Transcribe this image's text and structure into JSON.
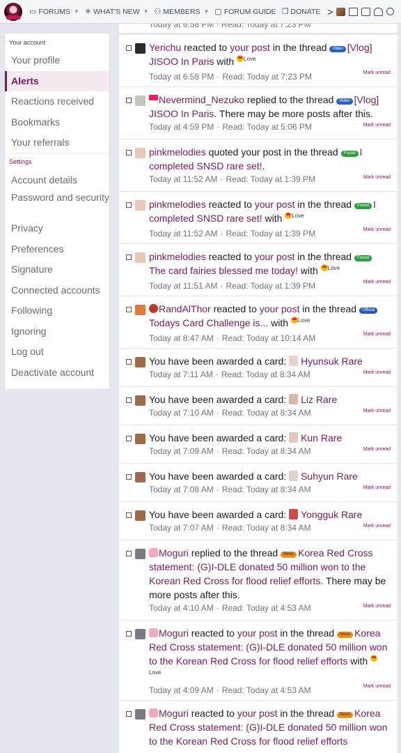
{
  "nav": {
    "items": [
      {
        "label": "FORUMS",
        "icon": "chat-icon",
        "caret": true
      },
      {
        "label": "WHAT'S NEW",
        "icon": "sparkle-icon",
        "caret": true
      },
      {
        "label": "MEMBERS",
        "icon": "members-icon",
        "caret": true
      },
      {
        "label": "FORUM GUIDE",
        "icon": "folder-icon",
        "caret": false
      },
      {
        "label": "DONATE",
        "icon": "gift-icon",
        "caret": false
      }
    ],
    "more_arrow": ">",
    "colors": {
      "bg": "#f5f6f8",
      "text": "#3d4a5f"
    }
  },
  "sidebar": {
    "account_heading": "Your account",
    "account_items": [
      {
        "label": "Your profile",
        "active": false
      },
      {
        "label": "Alerts",
        "active": true
      },
      {
        "label": "Reactions received",
        "active": false
      },
      {
        "label": "Bookmarks",
        "active": false
      },
      {
        "label": "Your referrals",
        "active": false
      }
    ],
    "settings_heading": "Settings",
    "settings_items": [
      {
        "label": "Account details",
        "two": false
      },
      {
        "label": "Password and security",
        "two": true
      },
      {
        "label": "Privacy",
        "two": false
      },
      {
        "label": "Preferences",
        "two": false
      },
      {
        "label": "Signature",
        "two": false
      },
      {
        "label": "Connected accounts",
        "two": false
      },
      {
        "label": "Following",
        "two": false
      },
      {
        "label": "Ignoring",
        "two": false
      },
      {
        "label": "Log out",
        "two": false
      },
      {
        "label": "Deactivate account",
        "two": false
      }
    ],
    "colors": {
      "accent": "#7b1a5a",
      "active_bg": "#f3eaf0"
    }
  },
  "alerts": {
    "mark_unread": "Mark unread",
    "read_label": "Read:",
    "partial_meta": "Today at 6:58 PM · Read: Today at 7:23 PM",
    "items": [
      {
        "user": "Yerichu",
        "action": "reacted to",
        "link": "your post",
        "in": "in the thread",
        "badge": "Video",
        "badge_type": "video",
        "thread": "[Vlog] JISOO In Paris",
        "with": "with",
        "reaction": "Love",
        "time": "Today at 6:58 PM",
        "read": "Today at 7:23 PM",
        "avatar": "#2b2b2b",
        "h": 75
      },
      {
        "user": "Nevermind_Nezuko",
        "action": "replied to the thread",
        "badge": "Video",
        "badge_type": "video",
        "thread": "[Vlog] JISOO In Paris",
        "suffix": ". There may be more posts after this.",
        "time": "Today at 4:59 PM",
        "read": "Today at 5:06 PM",
        "avatar": "#c9c3bd",
        "flag": true,
        "h": 75
      },
      {
        "user": "pinkmelodies",
        "action": "quoted your post in the thread",
        "badge": "Found",
        "badge_type": "found",
        "thread": "I completed SNSD rare set!",
        "suffix": ".",
        "time": "Today at 11:52 AM",
        "read": "Today at 1:39 PM",
        "avatar": "#e8c8b8",
        "h": 75
      },
      {
        "user": "pinkmelodies",
        "action": "reacted to",
        "link": "your post",
        "in": "in the thread",
        "badge": "Found",
        "badge_type": "found",
        "thread": "I completed SNSD rare set!",
        "with": "with",
        "reaction": "Love",
        "time": "Today at 11:52 AM",
        "read": "Today at 1:39 PM",
        "avatar": "#e8c8b8",
        "h": 75
      },
      {
        "user": "pinkmelodies",
        "action": "reacted to",
        "link": "your post",
        "in": "in the thread",
        "badge": "Found",
        "badge_type": "found",
        "thread": "The card fairies blessed me today!",
        "with": "with",
        "reaction": "Love",
        "time": "Today at 11:51 AM",
        "read": "Today at 1:39 PM",
        "avatar": "#e8c8b8",
        "h": 75
      },
      {
        "user": "RandAlThor",
        "action": "reacted to",
        "link": "your post",
        "in": "in the thread",
        "badge": "Official",
        "badge_type": "official",
        "thread": "Todays Card Challenge is...",
        "with": "with",
        "reaction": "Love",
        "time": "Today at 8:47 AM",
        "read": "Today at 10:14 AM",
        "avatar": "#e07a3a",
        "uicon": true,
        "h": 75
      },
      {
        "card_text": "You have been awarded a card:",
        "card": "Hyunsuk Rare",
        "card_color": "#e9d3c8",
        "time": "Today at 7:11 AM",
        "read": "Today at 8:34 AM",
        "avatar": "#9e6b4a",
        "h": 55
      },
      {
        "card_text": "You have been awarded a card:",
        "card": "Liz Rare",
        "card_color": "#d9b8a8",
        "time": "Today at 7:10 AM",
        "read": "Today at 8:34 AM",
        "avatar": "#9e6b4a",
        "h": 55
      },
      {
        "card_text": "You have been awarded a card:",
        "card": "Kun Rare",
        "card_color": "#e2c9bc",
        "time": "Today at 7:09 AM",
        "read": "Today at 8:34 AM",
        "avatar": "#9e6b4a",
        "h": 55
      },
      {
        "card_text": "You have been awarded a card:",
        "card": "Suhyun Rare",
        "card_color": "#dcd3cc",
        "time": "Today at 7:08 AM",
        "read": "Today at 8:34 AM",
        "avatar": "#9e6b4a",
        "h": 55
      },
      {
        "card_text": "You have been awarded a card:",
        "card": "Yongguk Rare",
        "card_color": "#cf4a4a",
        "time": "Today at 7:07 AM",
        "read": "Today at 8:34 AM",
        "avatar": "#9e6b4a",
        "h": 55
      },
      {
        "user": "Moguri",
        "action": "replied to the thread",
        "badge": "News",
        "badge_type": "news",
        "thread": "Korea Red Cross statement: (G)I-DLE donated 50 million won to the Korean Red Cross for flood relief efforts",
        "suffix": ". There may be more posts after this.",
        "time": "Today at 4:10 AM",
        "read": "Today at 4:53 AM",
        "avatar": "#7a7a85",
        "hand": true,
        "h": 115
      },
      {
        "user": "Moguri",
        "action": "reacted to",
        "link": "your post",
        "in": "in the thread",
        "badge": "News",
        "badge_type": "news",
        "thread": "Korea Red Cross statement: (G)I-DLE donated 50 million won to the Korean Red Cross for flood relief efforts",
        "with": "with",
        "reaction": "Love",
        "time": "Today at 4:09 AM",
        "read": "Today at 4:53 AM",
        "avatar": "#7a7a85",
        "hand": true,
        "h": 115
      },
      {
        "user": "Moguri",
        "action": "reacted to",
        "link": "your post",
        "in": "in the thread",
        "badge": "News",
        "badge_type": "news",
        "thread": "Korea Red Cross statement: (G)I-DLE donated 50 million won to the Korean Red Cross for flood relief efforts",
        "with": "",
        "reaction": "",
        "time": "",
        "read": "",
        "avatar": "#7a7a85",
        "hand": true,
        "h": 80
      }
    ]
  }
}
